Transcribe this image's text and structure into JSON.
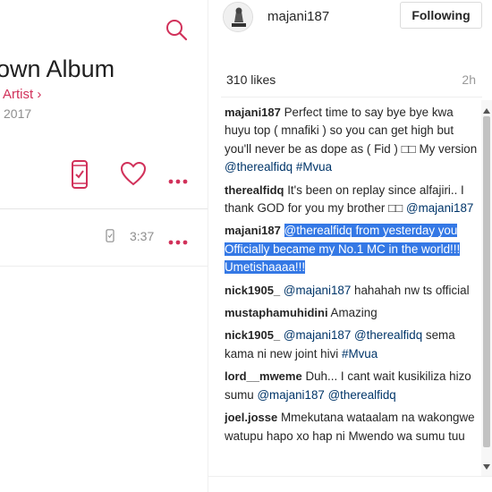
{
  "music": {
    "album_title": "own Album",
    "artist_link": "Artist ›",
    "year": "2017",
    "track": {
      "duration": "3:37"
    },
    "accent_color": "#d1315a",
    "icons": [
      "search-icon",
      "phone-check-icon",
      "heart-icon",
      "more-icon"
    ]
  },
  "post": {
    "username": "majani187",
    "follow_label": "Following",
    "likes": "310 likes",
    "time_ago": "2h"
  },
  "comments": [
    {
      "user": "majani187",
      "parts": [
        {
          "t": "Perfect time to say bye bye kwa huyu top ( mnafiki ) so you can get high but you'll never be as dope as ( Fid ) □□ My version "
        },
        {
          "t": "@therealfidq",
          "tag": true
        },
        {
          "t": " "
        },
        {
          "t": "#Mvua",
          "tag": true
        }
      ]
    },
    {
      "user": "therealfidq",
      "parts": [
        {
          "t": "It's been on replay since alfajiri.. I thank GOD for you my brother □□ "
        },
        {
          "t": "@majani187",
          "tag": true
        }
      ]
    },
    {
      "user": "majani187",
      "parts": [
        {
          "t": "@therealfidq from yesterday you Officially became my No.1 MC in the world!!! Umetishaaaa!!!",
          "highlight": true
        }
      ]
    },
    {
      "user": "nick1905_",
      "parts": [
        {
          "t": "@majani187",
          "tag": true
        },
        {
          "t": " hahahah nw ts official"
        }
      ]
    },
    {
      "user": "mustaphamuhidini",
      "parts": [
        {
          "t": "Amazing"
        }
      ]
    },
    {
      "user": "nick1905_",
      "parts": [
        {
          "t": "@majani187",
          "tag": true
        },
        {
          "t": " "
        },
        {
          "t": "@therealfidq",
          "tag": true
        },
        {
          "t": " sema kama ni new joint hivi "
        },
        {
          "t": "#Mvua",
          "tag": true
        }
      ]
    },
    {
      "user": "lord__mweme",
      "parts": [
        {
          "t": "Duh... I cant wait kusikiliza hizo sumu "
        },
        {
          "t": "@majani187",
          "tag": true
        },
        {
          "t": " "
        },
        {
          "t": "@therealfidq",
          "tag": true
        }
      ]
    },
    {
      "user": "joel.josse",
      "parts": [
        {
          "t": "Mmekutana wataalam na wakongwe watupu hapo xo hap ni Mwendo wa sumu tuu"
        }
      ]
    }
  ],
  "colors": {
    "tag": "#003569",
    "highlight": "#3478e5"
  }
}
